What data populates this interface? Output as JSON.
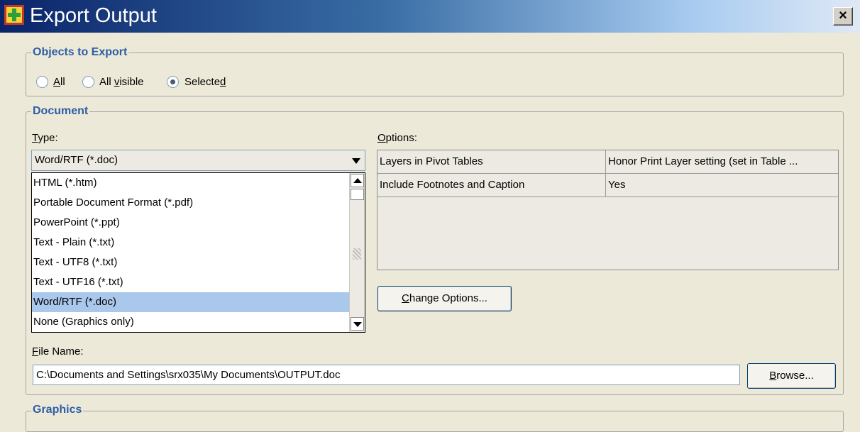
{
  "window": {
    "title": "Export Output",
    "app_icon": "spss-export-icon",
    "close_label": "×"
  },
  "objects_to_export": {
    "legend": "Objects to Export",
    "options": [
      {
        "mnemonic": "A",
        "rest": "ll",
        "selected": false
      },
      {
        "pre": "All ",
        "mnemonic": "v",
        "rest": "isible",
        "selected": false
      },
      {
        "pre": "Selecte",
        "mnemonic": "d",
        "rest": "",
        "selected": true
      }
    ]
  },
  "document": {
    "legend": "Document",
    "type_label": {
      "mnemonic": "T",
      "rest": "ype:"
    },
    "type_selected": "Word/RTF (*.doc)",
    "type_options": [
      "HTML (*.htm)",
      "Portable Document Format (*.pdf)",
      "PowerPoint (*.ppt)",
      "Text - Plain (*.txt)",
      "Text - UTF8 (*.txt)",
      "Text - UTF16 (*.txt)",
      "Word/RTF (*.doc)",
      "None (Graphics only)"
    ],
    "highlighted_option_index": 6,
    "options_label": {
      "mnemonic": "O",
      "rest": "ptions:"
    },
    "options_table": [
      {
        "name": "Layers in Pivot Tables",
        "value": "Honor Print Layer setting (set in Table ..."
      },
      {
        "name": "Include Footnotes and Caption",
        "value": "Yes"
      }
    ],
    "change_options_button": {
      "mnemonic": "C",
      "rest": "hange Options..."
    },
    "file_name_label": {
      "mnemonic": "F",
      "rest": "ile Name:"
    },
    "file_name_value": "C:\\Documents and Settings\\srx035\\My Documents\\OUTPUT.doc",
    "browse_button": {
      "mnemonic": "B",
      "rest": "rowse..."
    }
  },
  "graphics": {
    "legend": "Graphics"
  },
  "colors": {
    "titlebar_start": "#0a246a",
    "legend_text": "#2d5ea6",
    "selection": "#aac7ec",
    "dialog_bg": "#ece9d8"
  }
}
